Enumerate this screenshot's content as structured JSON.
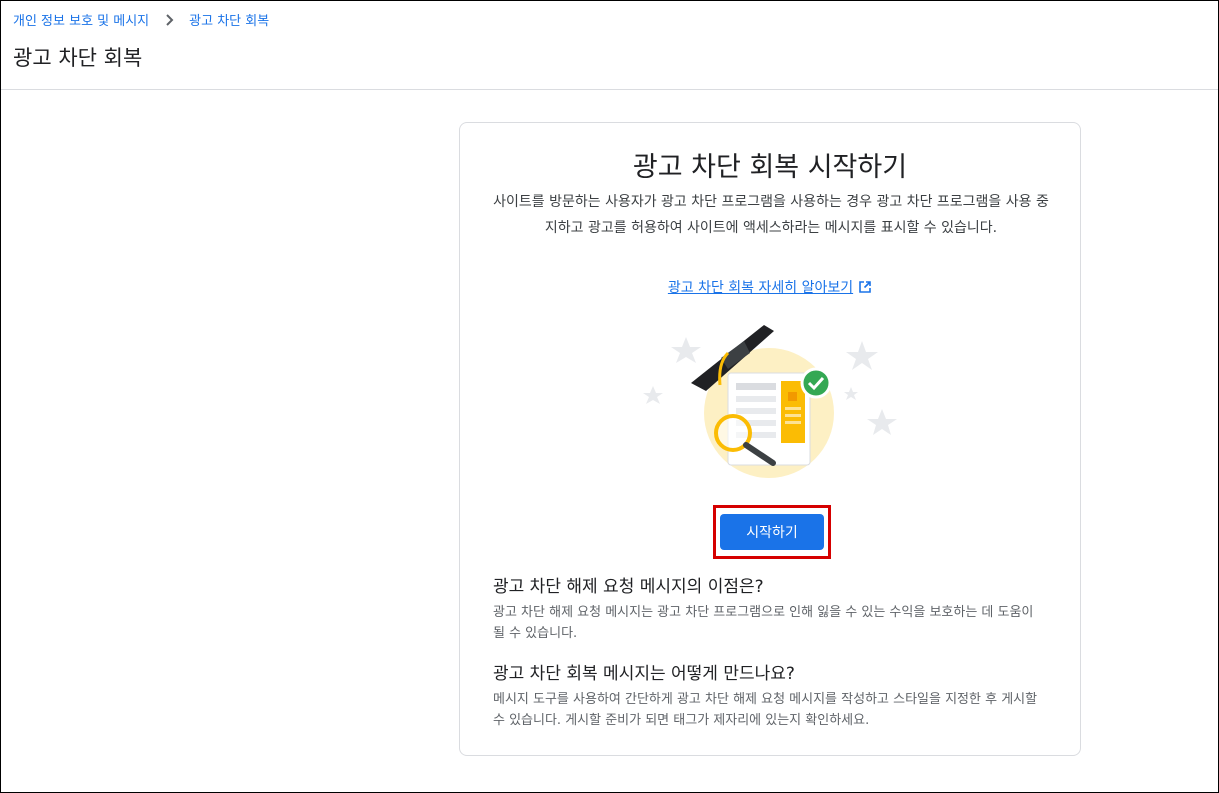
{
  "breadcrumb": {
    "parent": "개인 정보 보호 및 메시지",
    "current": "광고 차단 회복"
  },
  "page": {
    "title": "광고 차단 회복"
  },
  "card": {
    "title": "광고 차단 회복 시작하기",
    "description": "사이트를 방문하는 사용자가 광고 차단 프로그램을 사용하는 경우 광고 차단 프로그램을 사용 중지하고 광고를 허용하여 사이트에 액세스하라는 메시지를 표시할 수 있습니다.",
    "learn_more": "광고 차단 회복 자세히 알아보기",
    "start_button": "시작하기"
  },
  "faq": [
    {
      "question": "광고 차단 해제 요청 메시지의 이점은?",
      "answer": "광고 차단 해제 요청 메시지는 광고 차단 프로그램으로 인해 잃을 수 있는 수익을 보호하는 데 도움이 될 수 있습니다."
    },
    {
      "question": "광고 차단 회복 메시지는 어떻게 만드나요?",
      "answer": "메시지 도구를 사용하여 간단하게 광고 차단 해제 요청 메시지를 작성하고 스타일을 지정한 후 게시할 수 있습니다. 게시할 준비가 되면 태그가 제자리에 있는지 확인하세요."
    }
  ],
  "icons": {
    "breadcrumb_separator": "chevron-right-icon",
    "external_link": "open-in-new-icon",
    "illustration_check": "check-circle-icon"
  },
  "colors": {
    "link": "#1a73e8",
    "primary_button": "#1a73e8",
    "highlight": "#d50000",
    "check": "#34a853"
  }
}
